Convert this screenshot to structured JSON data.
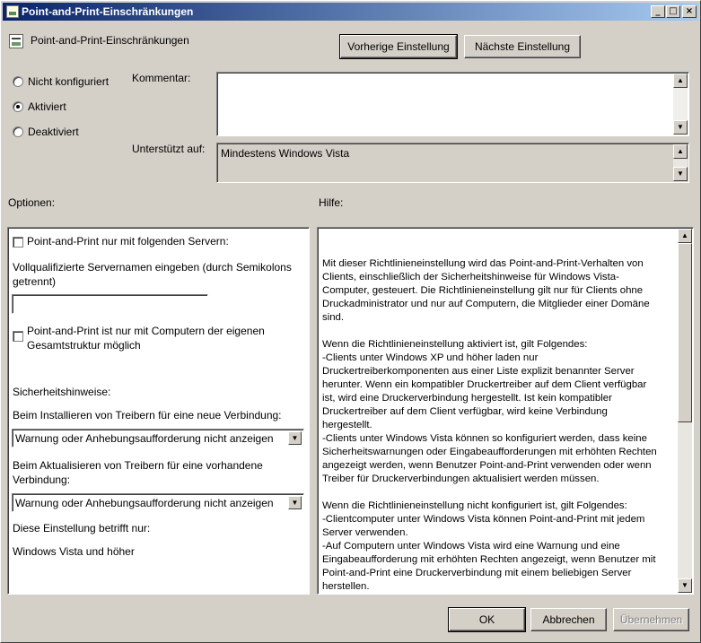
{
  "window": {
    "title": "Point-and-Print-Einschränkungen",
    "caption_buttons": [
      "_",
      "□",
      "×"
    ]
  },
  "header": {
    "policy_name": "Point-and-Print-Einschränkungen",
    "icon": "policy-setting-icon",
    "prev_button": "Vorherige Einstellung",
    "next_button": "Nächste Einstellung"
  },
  "state": {
    "options": [
      {
        "label": "Nicht konfiguriert",
        "selected": false
      },
      {
        "label": "Aktiviert",
        "selected": true
      },
      {
        "label": "Deaktiviert",
        "selected": false
      }
    ]
  },
  "comment": {
    "label": "Kommentar:",
    "value": ""
  },
  "supported": {
    "label": "Unterstützt auf:",
    "value": "Mindestens Windows Vista"
  },
  "options_section": {
    "label": "Optionen:",
    "check_servers": {
      "label": "Point-and-Print nur mit folgenden Servern:",
      "checked": false
    },
    "server_prompt": "Vollqualifizierte Servernamen eingeben (durch Semikolons getrennt)",
    "server_value": "",
    "check_forest": {
      "label": "Point-and-Print ist nur mit Computern der eigenen Gesamtstruktur möglich",
      "checked": false
    },
    "security_label": "Sicherheitshinweise:",
    "install_label": "Beim Installieren von Treibern für eine neue Verbindung:",
    "install_value": "Warnung oder Anhebungsaufforderung nicht anzeigen",
    "update_label": "Beim Aktualisieren von Treibern für eine vorhandene Verbindung:",
    "update_value": "Warnung oder Anhebungsaufforderung nicht anzeigen",
    "applies_label": "Diese Einstellung betrifft nur:",
    "applies_value": "Windows Vista und höher"
  },
  "help": {
    "label": "Hilfe:",
    "text": "Mit dieser Richtlinieneinstellung wird das Point-and-Print-Verhalten von\nClients, einschließlich der Sicherheitshinweise für Windows Vista-\nComputer, gesteuert. Die Richtlinieneinstellung gilt nur für Clients ohne\nDruckadministrator und nur auf Computern, die Mitglieder einer Domäne\nsind.\n\nWenn die Richtlinieneinstellung aktiviert ist, gilt Folgendes:\n-Clients unter Windows XP und höher laden nur\nDruckertreiberkomponenten aus einer Liste explizit benannter Server\nherunter. Wenn ein kompatibler Druckertreiber auf dem Client verfügbar\nist, wird eine Druckerverbindung hergestellt. Ist kein kompatibler\nDruckertreiber auf dem Client verfügbar, wird keine Verbindung\nhergestellt.\n-Clients unter Windows Vista können so konfiguriert werden, dass keine\nSicherheitswarnungen oder Eingabeaufforderungen mit erhöhten Rechten\nangezeigt werden, wenn Benutzer Point-and-Print verwenden oder wenn\nTreiber für Druckerverbindungen aktualisiert werden müssen.\n\nWenn die Richtlinieneinstellung nicht konfiguriert ist, gilt Folgendes:\n-Clientcomputer unter Windows Vista können Point-and-Print mit jedem\nServer verwenden.\n-Auf Computern unter Windows Vista wird eine Warnung und eine\nEingabeaufforderung mit erhöhten Rechten angezeigt, wenn Benutzer mit\nPoint-and-Print eine Druckerverbindung mit einem beliebigen Server\nherstellen."
  },
  "footer": {
    "ok": "OK",
    "cancel": "Abbrechen",
    "apply": "Übernehmen"
  }
}
